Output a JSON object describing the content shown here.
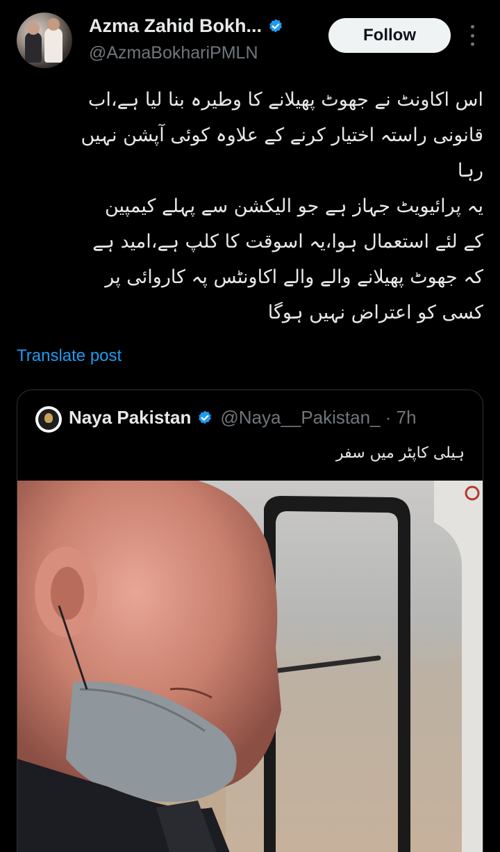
{
  "author": {
    "display_name": "Azma Zahid Bokh...",
    "handle": "@AzmaBokhariPMLN",
    "verified": true,
    "follow_label": "Follow"
  },
  "post": {
    "lines": [
      "اس اکاونٹ نے جھوٹ پھیلانے کا وطیرہ بنا لیا ہے،اب",
      "قانونی راستہ اختیار کرنے کے علاوہ کوئی آپشن نہیں",
      "رہا",
      "یہ پرائیویٹ جہاز ہے جو الیکشن سے پہلے کیمپین",
      "کے لئے استعمال ہوا،یہ اسوقت کا کلپ ہے،امید ہے",
      "کہ جھوٹ پھیلانے والے والے اکاونٹس پہ کاروائی پر",
      "کسی کو اعتراض نہیں ہوگا"
    ],
    "translate_label": "Translate post"
  },
  "quoted": {
    "name": "Naya Pakistan",
    "handle_time": "@Naya__Pakistan_ · 7h",
    "verified": true,
    "text": "ہیلی کاپٹر میں سفر"
  },
  "colors": {
    "background": "#000000",
    "text": "#e7e9ea",
    "secondary": "#71767b",
    "link": "#1d9bf0",
    "verified": "#1d9bf0",
    "border": "#2f3336"
  }
}
